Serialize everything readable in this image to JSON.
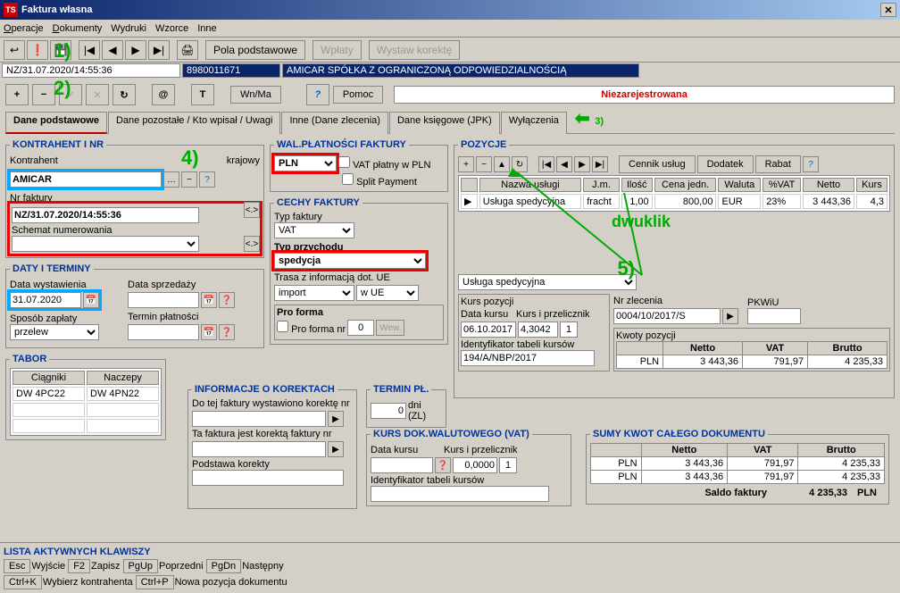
{
  "window": {
    "title": "Faktura własna"
  },
  "menu": {
    "operacje": "Operacje",
    "dokumenty": "Dokumenty",
    "wydruki": "Wydruki",
    "wzorce": "Wzorce",
    "inne": "Inne"
  },
  "toolbar": {
    "pola": "Pola podstawowe",
    "wplaty": "Wpłaty",
    "korekta": "Wystaw korektę"
  },
  "status": {
    "nr": "NZ/31.07.2020/14:55:36",
    "id": "8980011671",
    "name": "AMICAR SPÓŁKA Z OGRANICZONĄ ODPOWIEDZIALNOŚCIĄ"
  },
  "actions": {
    "wnma": "Wn/Ma",
    "pomoc": "Pomoc",
    "status": "Niezarejestrowana"
  },
  "tabs": {
    "t1": "Dane podstawowe",
    "t2": "Dane pozostałe / Kto wpisał / Uwagi",
    "t3": "Inne (Dane zlecenia)",
    "t4": "Dane księgowe (JPK)",
    "t5": "Wyłączenia"
  },
  "kontrahent": {
    "legend": "KONTRAHENT I NR",
    "lbl1": "Kontrahent",
    "lbl2": "krajowy",
    "value": "AMICAR",
    "nrfak": "Nr faktury",
    "nrval": "NZ/31.07.2020/14:55:36",
    "schemat": "Schemat numerowania"
  },
  "daty": {
    "legend": "DATY I TERMINY",
    "wyst": "Data wystawienia",
    "wystval": "31.07.2020",
    "sprz": "Data sprzedaży",
    "sposob": "Sposób zapłaty",
    "sposobval": "przelew",
    "termin": "Termin płatności"
  },
  "tabor": {
    "legend": "TABOR",
    "col1": "Ciągniki",
    "col2": "Naczepy",
    "v1": "DW 4PC22",
    "v2": "DW 4PN22"
  },
  "waluta": {
    "legend": "WAL.PŁATNOŚCI FAKTURY",
    "val": "PLN",
    "vat": "VAT płatny w PLN",
    "split": "Split Payment"
  },
  "cechy": {
    "legend": "CECHY FAKTURY",
    "typ": "Typ faktury",
    "typval": "VAT",
    "przych": "Typ przychodu",
    "przychval": "spedycja",
    "trasa": "Trasa z informacją dot. UE",
    "trasaval": "import",
    "ue": "w UE",
    "proforma": "Pro forma",
    "proformalbl": "Pro forma nr",
    "proformaval": "0",
    "wew": "Wew."
  },
  "korekty": {
    "legend": "INFORMACJE O KOREKTACH",
    "l1": "Do tej faktury wystawiono korektę nr",
    "l2": "Ta faktura jest korektą faktury nr",
    "l3": "Podstawa korekty"
  },
  "terminpl": {
    "legend": "TERMIN PŁ.",
    "dni": "dni",
    "zl": "(ZL)",
    "val": "0"
  },
  "kursdok": {
    "legend": "KURS DOK.WALUTOWEGO (VAT)",
    "data": "Data kursu",
    "kurs": "Kurs i przelicznik",
    "kursval": "0,0000",
    "one": "1",
    "ident": "Identyfikator tabeli kursów"
  },
  "pozycje": {
    "legend": "POZYCJE",
    "cennik": "Cennik usług",
    "dodatek": "Dodatek",
    "rabat": "Rabat",
    "cols": {
      "nazwa": "Nazwa usługi",
      "jm": "J.m.",
      "ilosc": "Ilość",
      "cena": "Cena jedn.",
      "waluta": "Waluta",
      "vat": "%VAT",
      "netto": "Netto",
      "kurs": "Kurs"
    },
    "row": {
      "nazwa": "Usługa spedycyjna",
      "jm": "fracht",
      "ilosc": "1,00",
      "cena": "800,00",
      "waluta": "EUR",
      "vat": "23%",
      "netto": "3 443,36",
      "kurs": "4,3"
    },
    "sel": "Usługa spedycyjna",
    "kurspoz": "Kurs pozycji",
    "datakursu": "Data kursu",
    "datakursuval": "06.10.2017",
    "kursprzel": "Kurs i przelicznik",
    "kursval": "4,3042",
    "one": "1",
    "identtab": "Identyfikator tabeli kursów",
    "identval": "194/A/NBP/2017",
    "nrzlec": "Nr zlecenia",
    "nrzlecval": "0004/10/2017/S",
    "pkwiu": "PKWiU",
    "kwoty": "Kwoty pozycji",
    "netto": "Netto",
    "vat2": "VAT",
    "brutto": "Brutto",
    "kw_pln": "PLN",
    "kw_netto": "3 443,36",
    "kw_vat": "791,97",
    "kw_brutto": "4 235,33"
  },
  "sumy": {
    "legend": "SUMY KWOT CAŁEGO DOKUMENTU",
    "netto": "Netto",
    "vat": "VAT",
    "brutto": "Brutto",
    "pln": "PLN",
    "r1n": "3 443,36",
    "r1v": "791,97",
    "r1b": "4 235,33",
    "r2n": "3 443,36",
    "r2v": "791,97",
    "r2b": "4 235,33",
    "saldo": "Saldo faktury",
    "saldoval": "4 235,33",
    "saldocur": "PLN"
  },
  "footer": {
    "title": "LISTA AKTYWNYCH KLAWISZY",
    "esc": "Esc",
    "wyjscie": "Wyjście",
    "f2": "F2",
    "zapisz": "Zapisz",
    "pgup": "PgUp",
    "poprzedni": "Poprzedni",
    "pgdn": "PgDn",
    "nastepny": "Następny",
    "ctrlk": "Ctrl+K",
    "wybkon": "Wybierz kontrahenta",
    "ctrlp": "Ctrl+P",
    "nowapoz": "Nowa pozycja dokumentu"
  },
  "annot": {
    "a1": "1)",
    "a2": "2)",
    "a3": "3)",
    "a4": "4)",
    "a5": "5)",
    "dwuklik": "dwuklik"
  }
}
